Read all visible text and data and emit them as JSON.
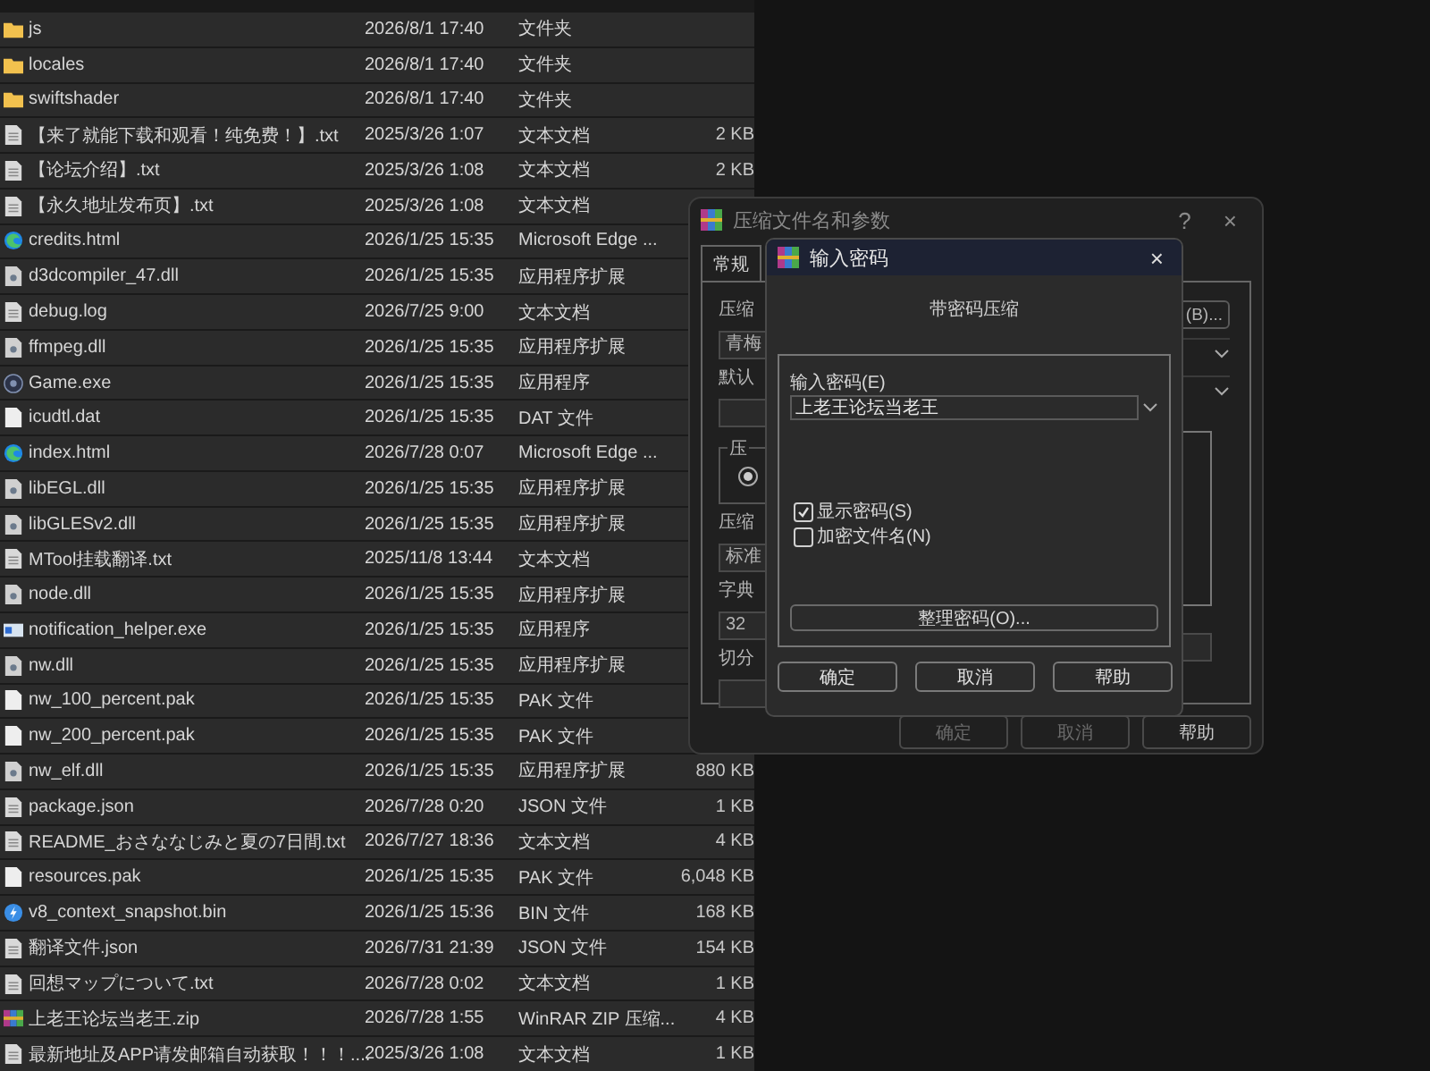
{
  "files": [
    {
      "kind": "folder",
      "name": "js",
      "modified": "2026/8/1 17:40",
      "type": "文件夹"
    },
    {
      "kind": "folder",
      "name": "locales",
      "modified": "2026/8/1 17:40",
      "type": "文件夹"
    },
    {
      "kind": "folder",
      "name": "swiftshader",
      "modified": "2026/8/1 17:40",
      "type": "文件夹"
    },
    {
      "kind": "text",
      "name": "【来了就能下载和观看！纯免费！】.txt",
      "modified": "2025/3/26 1:07",
      "type": "文本文档",
      "size": "2 KB"
    },
    {
      "kind": "text",
      "name": "【论坛介绍】.txt",
      "modified": "2025/3/26 1:08",
      "type": "文本文档",
      "size": "2 KB"
    },
    {
      "kind": "text",
      "name": "【永久地址发布页】.txt",
      "modified": "2025/3/26 1:08",
      "type": "文本文档"
    },
    {
      "kind": "browser",
      "name": "credits.html",
      "modified": "2026/1/25 15:35",
      "type": "Microsoft Edge ..."
    },
    {
      "kind": "library",
      "name": "d3dcompiler_47.dll",
      "modified": "2026/1/25 15:35",
      "type": "应用程序扩展"
    },
    {
      "kind": "text",
      "name": "debug.log",
      "modified": "2026/7/25 9:00",
      "type": "文本文档"
    },
    {
      "kind": "library",
      "name": "ffmpeg.dll",
      "modified": "2026/1/25 15:35",
      "type": "应用程序扩展"
    },
    {
      "kind": "game",
      "name": "Game.exe",
      "modified": "2026/1/25 15:35",
      "type": "应用程序"
    },
    {
      "kind": "blank",
      "name": "icudtl.dat",
      "modified": "2026/1/25 15:35",
      "type": "DAT 文件"
    },
    {
      "kind": "browser",
      "name": "index.html",
      "modified": "2026/7/28 0:07",
      "type": "Microsoft Edge ..."
    },
    {
      "kind": "library",
      "name": "libEGL.dll",
      "modified": "2026/1/25 15:35",
      "type": "应用程序扩展"
    },
    {
      "kind": "library",
      "name": "libGLESv2.dll",
      "modified": "2026/1/25 15:35",
      "type": "应用程序扩展"
    },
    {
      "kind": "text",
      "name": "MTool挂载翻译.txt",
      "modified": "2025/11/8 13:44",
      "type": "文本文档"
    },
    {
      "kind": "library",
      "name": "node.dll",
      "modified": "2026/1/25 15:35",
      "type": "应用程序扩展"
    },
    {
      "kind": "app",
      "name": "notification_helper.exe",
      "modified": "2026/1/25 15:35",
      "type": "应用程序"
    },
    {
      "kind": "library",
      "name": "nw.dll",
      "modified": "2026/1/25 15:35",
      "type": "应用程序扩展"
    },
    {
      "kind": "blank",
      "name": "nw_100_percent.pak",
      "modified": "2026/1/25 15:35",
      "type": "PAK 文件"
    },
    {
      "kind": "blank",
      "name": "nw_200_percent.pak",
      "modified": "2026/1/25 15:35",
      "type": "PAK 文件"
    },
    {
      "kind": "library",
      "name": "nw_elf.dll",
      "modified": "2026/1/25 15:35",
      "type": "应用程序扩展",
      "size": "880 KB"
    },
    {
      "kind": "text",
      "name": "package.json",
      "modified": "2026/7/28 0:20",
      "type": "JSON 文件",
      "size": "1 KB"
    },
    {
      "kind": "text",
      "name": "README_おさななじみと夏の7日間.txt",
      "modified": "2026/7/27 18:36",
      "type": "文本文档",
      "size": "4 KB"
    },
    {
      "kind": "blank",
      "name": "resources.pak",
      "modified": "2026/1/25 15:35",
      "type": "PAK 文件",
      "size": "6,048 KB"
    },
    {
      "kind": "binary",
      "name": "v8_context_snapshot.bin",
      "modified": "2026/1/25 15:36",
      "type": "BIN 文件",
      "size": "168 KB"
    },
    {
      "kind": "text",
      "name": "翻译文件.json",
      "modified": "2026/7/31 21:39",
      "type": "JSON 文件",
      "size": "154 KB"
    },
    {
      "kind": "text",
      "name": "回想マップについて.txt",
      "modified": "2026/7/28 0:02",
      "type": "文本文档",
      "size": "1 KB"
    },
    {
      "kind": "archive",
      "name": "上老王论坛当老王.zip",
      "modified": "2026/7/28 1:55",
      "type": "WinRAR ZIP 压缩...",
      "size": "4 KB"
    },
    {
      "kind": "text",
      "name": "最新地址及APP请发邮箱自动获取！！！....",
      "modified": "2025/3/26 1:08",
      "type": "文本文档",
      "size": "1 KB"
    }
  ],
  "archive_dialog": {
    "title": "压缩文件名和参数",
    "help": "?",
    "close": "×",
    "tabs": [
      {
        "label": "常规",
        "selected": true
      }
    ],
    "left": [
      {
        "kind": "label",
        "text": "压缩"
      },
      {
        "kind": "field",
        "value": "青梅"
      },
      {
        "kind": "label",
        "text": "默认"
      },
      {
        "kind": "field"
      },
      {
        "kind": "group",
        "text": "压",
        "selected": true
      },
      {
        "kind": "label",
        "text": "压缩"
      },
      {
        "kind": "field",
        "value": "标准"
      },
      {
        "kind": "label",
        "text": "字典"
      },
      {
        "kind": "field",
        "value": "32"
      },
      {
        "kind": "label",
        "text": "切分"
      },
      {
        "kind": "field"
      }
    ],
    "right": [
      {
        "kind": "button",
        "text": "(B)..."
      },
      {
        "kind": "combo"
      },
      {
        "kind": "combo"
      },
      {
        "kind": "list"
      },
      {
        "kind": "field"
      }
    ],
    "buttons": [
      {
        "label": "确定",
        "disabled": true
      },
      {
        "label": "取消",
        "disabled": true
      },
      {
        "label": "帮助",
        "disabled": false
      }
    ]
  },
  "password_dialog": {
    "title": "输入密码",
    "close": "×",
    "heading": "带密码压缩",
    "password_label": "输入密码(E)",
    "password_value": "上老王论坛当老王",
    "options": [
      {
        "label": "显示密码(S)",
        "checked": true
      },
      {
        "label": "加密文件名(N)",
        "checked": false
      }
    ],
    "organize_button": "整理密码(O)...",
    "buttons": [
      "确定",
      "取消",
      "帮助"
    ]
  }
}
